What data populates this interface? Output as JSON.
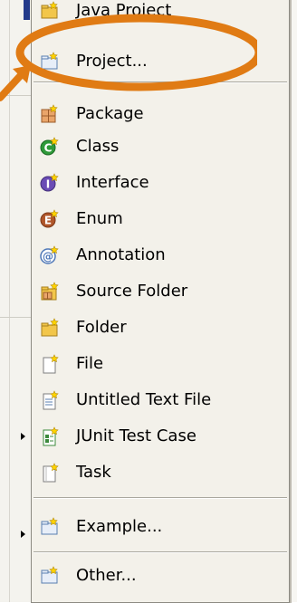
{
  "menu": {
    "items": [
      {
        "label": "Java Project",
        "icon": "java-project-icon"
      },
      {
        "label": "Project...",
        "icon": "project-icon"
      },
      {
        "label": "Package",
        "icon": "package-icon"
      },
      {
        "label": "Class",
        "icon": "class-icon"
      },
      {
        "label": "Interface",
        "icon": "interface-icon"
      },
      {
        "label": "Enum",
        "icon": "enum-icon"
      },
      {
        "label": "Annotation",
        "icon": "annotation-icon"
      },
      {
        "label": "Source Folder",
        "icon": "source-folder-icon"
      },
      {
        "label": "Folder",
        "icon": "folder-icon"
      },
      {
        "label": "File",
        "icon": "file-icon"
      },
      {
        "label": "Untitled Text File",
        "icon": "untitled-text-file-icon"
      },
      {
        "label": "JUnit Test Case",
        "icon": "junit-test-case-icon"
      },
      {
        "label": "Task",
        "icon": "task-icon"
      },
      {
        "label": "Example...",
        "icon": "example-icon"
      },
      {
        "label": "Other...",
        "icon": "other-icon"
      }
    ]
  },
  "colors": {
    "highlight": "#e07b14",
    "menu_background": "#f3f1ea",
    "class_green": "#2f9a3a",
    "interface_purple": "#6a4bb5",
    "enum_brown": "#b0562a",
    "folder_yellow": "#f2c64a"
  }
}
